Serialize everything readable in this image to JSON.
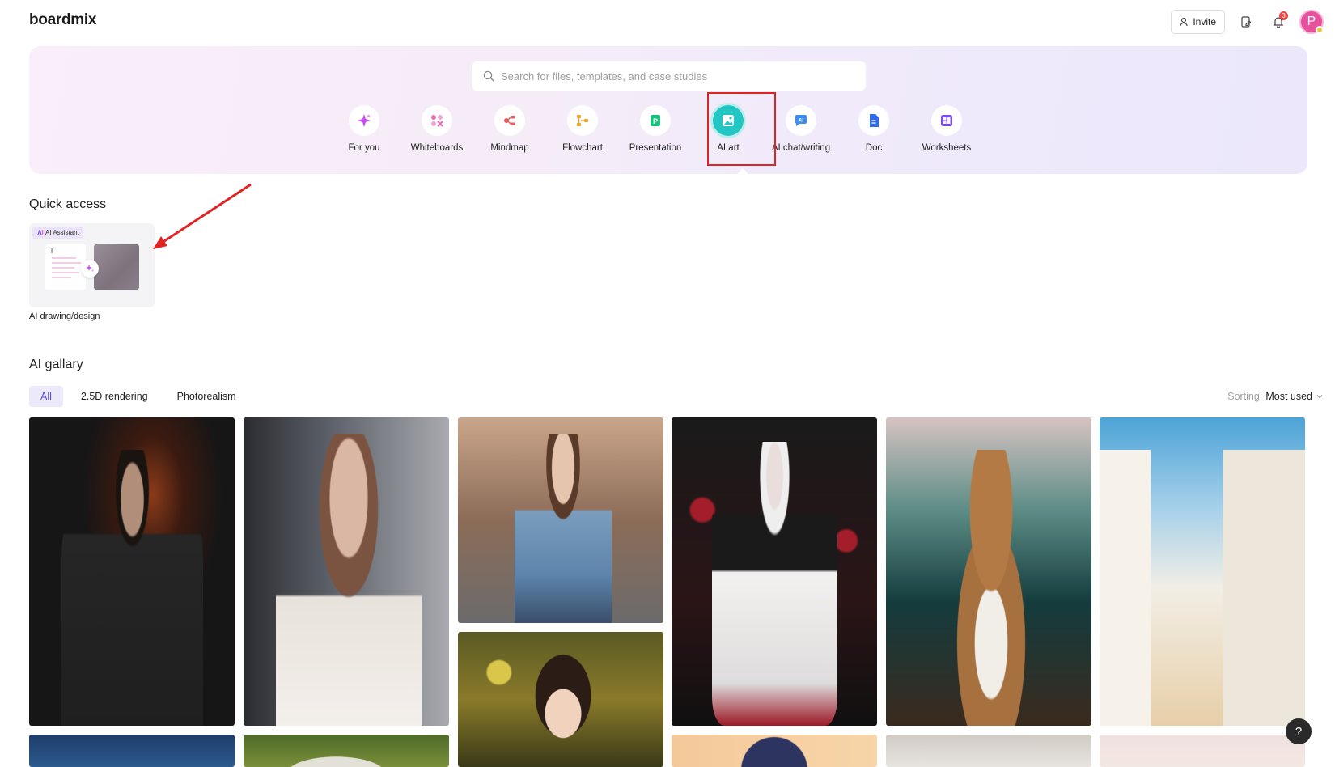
{
  "header": {
    "logo": "boardmix",
    "invite_label": "Invite",
    "notification_count": "3",
    "avatar_initial": "P"
  },
  "search": {
    "placeholder": "Search for files, templates, and case studies"
  },
  "categories": [
    {
      "label": "For you",
      "icon": "sparkle-icon",
      "color": "#c94ff0"
    },
    {
      "label": "Whiteboards",
      "icon": "whiteboard-icon",
      "color": "#e86ab8"
    },
    {
      "label": "Mindmap",
      "icon": "mindmap-icon",
      "color": "#ef5a5a"
    },
    {
      "label": "Flowchart",
      "icon": "flowchart-icon",
      "color": "#f5a623"
    },
    {
      "label": "Presentation",
      "icon": "presentation-icon",
      "color": "#18c27a"
    },
    {
      "label": "AI art",
      "icon": "ai-art-icon",
      "color": "#22c7c3",
      "active": true
    },
    {
      "label": "AI chat/writing",
      "icon": "ai-chat-icon",
      "color": "#3b8cf5"
    },
    {
      "label": "Doc",
      "icon": "doc-icon",
      "color": "#2f6bf0"
    },
    {
      "label": "Worksheets",
      "icon": "worksheet-icon",
      "color": "#7b4cf0"
    }
  ],
  "quick_access": {
    "title": "Quick access",
    "card_tag": "AI Assistant",
    "card_label": "AI drawing/design"
  },
  "gallery": {
    "title": "AI gallary",
    "filters": [
      "All",
      "2.5D rendering",
      "Photorealism"
    ],
    "selected_filter": "All",
    "sorting_key": "Sorting:",
    "sorting_value": "Most used"
  },
  "colors": {
    "annotation": "#e02424",
    "accent": "#5b4fd8"
  },
  "help_label": "?"
}
